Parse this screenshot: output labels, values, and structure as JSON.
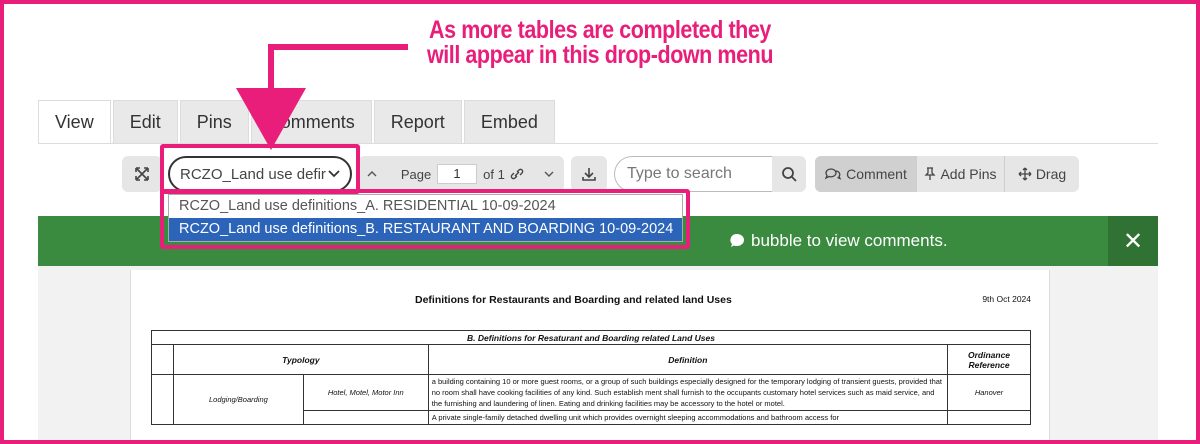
{
  "callout": {
    "line1": "As more tables are completed they",
    "line2": "will appear in this drop-down menu"
  },
  "tabs": [
    {
      "label": "View",
      "active": true
    },
    {
      "label": "Edit"
    },
    {
      "label": "Pins"
    },
    {
      "label": "Comments"
    },
    {
      "label": "Report"
    },
    {
      "label": "Embed"
    }
  ],
  "toolbar": {
    "select_value": "RCZO_Land use defir",
    "page_label": "Page",
    "page_value": "1",
    "page_of": "of 1",
    "search_placeholder": "Type to search",
    "comment_label": "Comment",
    "add_pins_label": "Add Pins",
    "drag_label": "Drag"
  },
  "dropdown": {
    "options": [
      "RCZO_Land use definitions_A. RESIDENTIAL 10-09-2024",
      "RCZO_Land use definitions_B. RESTAURANT AND BOARDING 10-09-2024"
    ],
    "selected_index": 1
  },
  "banner": {
    "message": "bubble to view comments.",
    "close": "✕"
  },
  "document": {
    "title": "Definitions for Restaurants and Boarding and related land Uses",
    "date": "9th Oct 2024",
    "table_caption": "B. Definitions for Resaturant and Boarding related Land Uses",
    "headers": [
      "Typology",
      "Definition",
      "Ordinance Reference"
    ],
    "rows": [
      {
        "subtype": "Hotel, Motel, Motor Inn",
        "definition": "a building containing 10 or more guest rooms, or a group of such buildings especially designed for the temporary lodging of transient guests, provided that no room shall have cooking facilities of any kind. Such establish ment shall furnish to the occupants customary hotel services such as maid service, and the furnishing and laundering of linen. Eating and drinking facilities may be accessory to the hotel or motel.",
        "reference": "Hanover"
      },
      {
        "typology": "Lodging/Boarding",
        "definition": "A private single-family detached dwelling unit which provides overnight sleeping accommodations and bathroom access for"
      }
    ]
  },
  "colors": {
    "accent": "#e91e7a",
    "banner_green": "#3a8a3f",
    "selected_blue": "#2b64b8"
  }
}
